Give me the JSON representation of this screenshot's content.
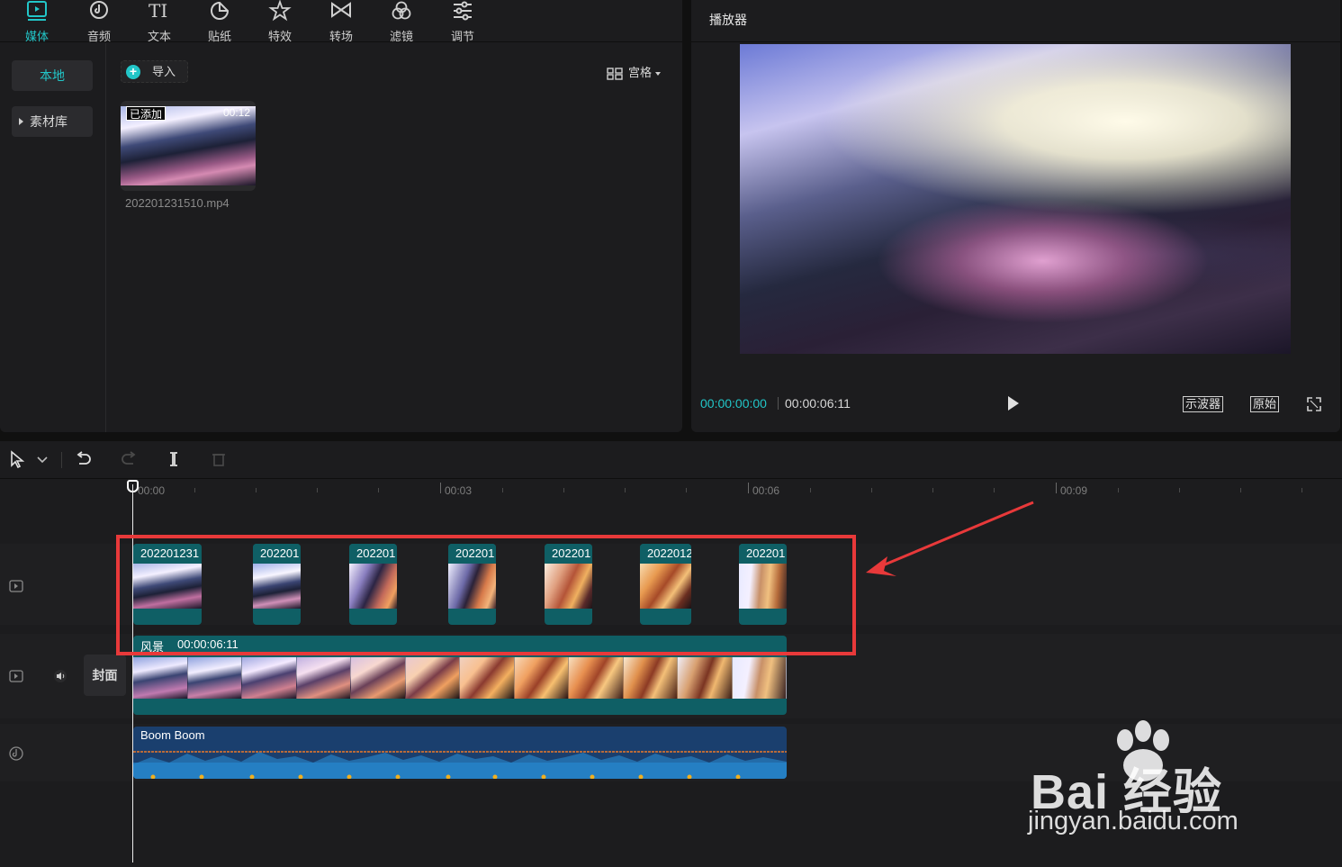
{
  "toolbar": {
    "tabs": [
      {
        "label": "媒体",
        "icon": "media-icon",
        "active": true
      },
      {
        "label": "音频",
        "icon": "audio-icon"
      },
      {
        "label": "文本",
        "icon": "text-icon"
      },
      {
        "label": "贴纸",
        "icon": "sticker-icon"
      },
      {
        "label": "特效",
        "icon": "effects-icon"
      },
      {
        "label": "转场",
        "icon": "transition-icon"
      },
      {
        "label": "滤镜",
        "icon": "filter-icon"
      },
      {
        "label": "调节",
        "icon": "adjust-icon"
      }
    ]
  },
  "sidebar": {
    "local": "本地",
    "library": "素材库"
  },
  "media": {
    "import_label": "导入",
    "view_label": "宫格",
    "card": {
      "badge": "已添加",
      "duration": "00:12",
      "filename": "202201231510.mp4"
    }
  },
  "player": {
    "title": "播放器",
    "current_time": "00:00:00:00",
    "total_time": "00:00:06:11",
    "scope_label": "示波器",
    "original_label": "原始"
  },
  "timeline": {
    "ruler_labels": [
      "00:00",
      "00:03",
      "00:06",
      "00:09"
    ],
    "cover_label": "封面",
    "clips": [
      {
        "label": "202201231"
      },
      {
        "label": "202201"
      },
      {
        "label": "202201"
      },
      {
        "label": "202201"
      },
      {
        "label": "202201"
      },
      {
        "label": "2022012"
      },
      {
        "label": "202201"
      }
    ],
    "main_clip": {
      "name": "风景",
      "duration": "00:00:06:11"
    },
    "audio_clip": {
      "name": "Boom Boom"
    }
  },
  "watermark": {
    "brand": "Bai 经验",
    "url": "jingyan.baidu.com"
  },
  "colors": {
    "accent": "#22c6c8",
    "clip": "#0f5f65",
    "audio": "#1a3f6e",
    "highlight": "#e8393a"
  }
}
